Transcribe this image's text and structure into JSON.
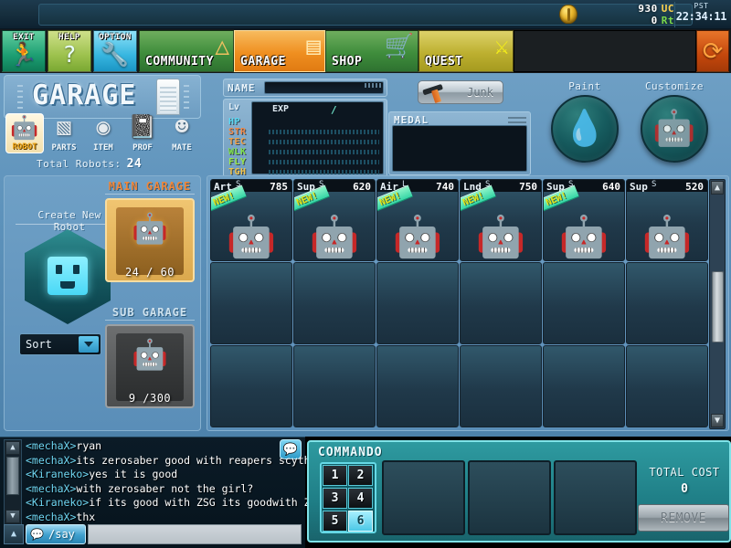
{
  "topbar": {
    "currency_amount": "930",
    "currency_unit": "UC",
    "points_amount": "0",
    "points_unit": "Rt",
    "timezone": "PST",
    "clock": "22:34:11",
    "coin_icon": "coin-icon"
  },
  "nav": {
    "exit": {
      "label": "EXIT",
      "icon": "running-person-icon"
    },
    "help": {
      "label": "HELP",
      "icon": "question-mark-icon"
    },
    "option": {
      "label": "OPTION",
      "icon": "wrench-icon"
    },
    "community": {
      "label": "COMMUNITY",
      "icon": "house-icon"
    },
    "garage": {
      "label": "GARAGE",
      "icon": "garage-door-icon"
    },
    "shop": {
      "label": "SHOP",
      "icon": "shopping-cart-icon"
    },
    "quest": {
      "label": "QUEST",
      "icon": "crossed-swords-icon"
    },
    "refresh": {
      "icon": "refresh-icon"
    }
  },
  "garage_panel": {
    "title": "GARAGE",
    "tabs": [
      {
        "label": "ROBOT",
        "icon": "robot-icon",
        "active": true
      },
      {
        "label": "PARTS",
        "icon": "parts-box-icon",
        "active": false
      },
      {
        "label": "ITEM",
        "icon": "item-bundle-icon",
        "active": false
      },
      {
        "label": "PROF",
        "icon": "notebook-pen-icon",
        "active": false
      },
      {
        "label": "MATE",
        "icon": "face-icon",
        "active": false
      }
    ],
    "total_robots_label": "Total Robots:",
    "total_robots_value": "24"
  },
  "stats": {
    "name_label": "NAME",
    "name_value": "",
    "lv_label": "Lv",
    "lv_value": "",
    "exp_label": "EXP",
    "exp_separator": "/",
    "rows": [
      {
        "label": "HP",
        "color": "#59d8f2"
      },
      {
        "label": "STR",
        "color": "#f08a4a"
      },
      {
        "label": "TEC",
        "color": "#f0a24a"
      },
      {
        "label": "WLK",
        "color": "#7fe04a"
      },
      {
        "label": "FLY",
        "color": "#9ae84a"
      },
      {
        "label": "TGH",
        "color": "#f0c24a"
      }
    ],
    "medal_label": "MEDAL",
    "junk_label": "Junk"
  },
  "actions": {
    "paint": {
      "label": "Paint",
      "icon": "spray-can-icon"
    },
    "customize": {
      "label": "Customize",
      "icon": "robot-body-icon"
    }
  },
  "sidebar": {
    "create_label": "Create New Robot",
    "create_icon": "robot-face-hex-icon",
    "sort_label": "Sort",
    "sort_icon": "chevron-down-icon",
    "main_garage": {
      "header": "MAIN  GARAGE",
      "count": "24 / 60",
      "icon": "orange-robot-icon"
    },
    "sub_garage": {
      "header": "SUB  GARAGE",
      "count": "9  /300",
      "icon": "grey-robot-icon"
    }
  },
  "robot_grid": {
    "columns": 6,
    "rows": 3,
    "new_badge_label": "NEW!",
    "cells": [
      {
        "type": "Art",
        "rank": "S",
        "power": "785",
        "is_new": true,
        "mech": "robot-dark-artillery",
        "color": "#3b3b44"
      },
      {
        "type": "Sup",
        "rank": "S",
        "power": "620",
        "is_new": true,
        "mech": "robot-blue-support",
        "color": "#4fb8e8"
      },
      {
        "type": "Air",
        "rank": "L",
        "power": "740",
        "is_new": true,
        "mech": "robot-gold-air",
        "color": "#e8c019"
      },
      {
        "type": "Lnd",
        "rank": "S",
        "power": "750",
        "is_new": true,
        "mech": "robot-red-land",
        "color": "#c4483a"
      },
      {
        "type": "Sup",
        "rank": "S",
        "power": "640",
        "is_new": true,
        "mech": "robot-navy-support",
        "color": "#3a4a88"
      },
      {
        "type": "Sup",
        "rank": "S",
        "power": "520",
        "is_new": false,
        "mech": "robot-purple-support",
        "color": "#a276c8"
      }
    ],
    "scrollbar": {
      "up_icon": "chevron-up-icon",
      "down_icon": "chevron-down-icon"
    }
  },
  "chat": {
    "messages": [
      {
        "nick": "<mechaX>",
        "text": "ryan"
      },
      {
        "nick": "<mechaX>",
        "text": "its zerosaber good with reapers scythe?"
      },
      {
        "nick": "<Kiraneko>",
        "text": "yes it is good"
      },
      {
        "nick": "<mechaX>",
        "text": "with zerosaber not the girl?"
      },
      {
        "nick": "<Kiraneko>",
        "text": "if its good with ZSG its goodwith ZS"
      },
      {
        "nick": "<mechaX>",
        "text": "thx"
      }
    ],
    "mode_label": "/say",
    "mode_icon": "speech-bubble-icon",
    "input_value": "",
    "expand_icon": "chevron-up-icon",
    "bubble_icon": "speech-bubble-icon"
  },
  "commando": {
    "title": "COMMANDO",
    "keys": [
      "1",
      "2",
      "3",
      "4",
      "5",
      "6"
    ],
    "selected_key": "6",
    "slots": [
      "",
      "",
      ""
    ],
    "total_cost_label": "TOTAL COST",
    "total_cost_value": "0",
    "remove_label": "REMOVE"
  }
}
